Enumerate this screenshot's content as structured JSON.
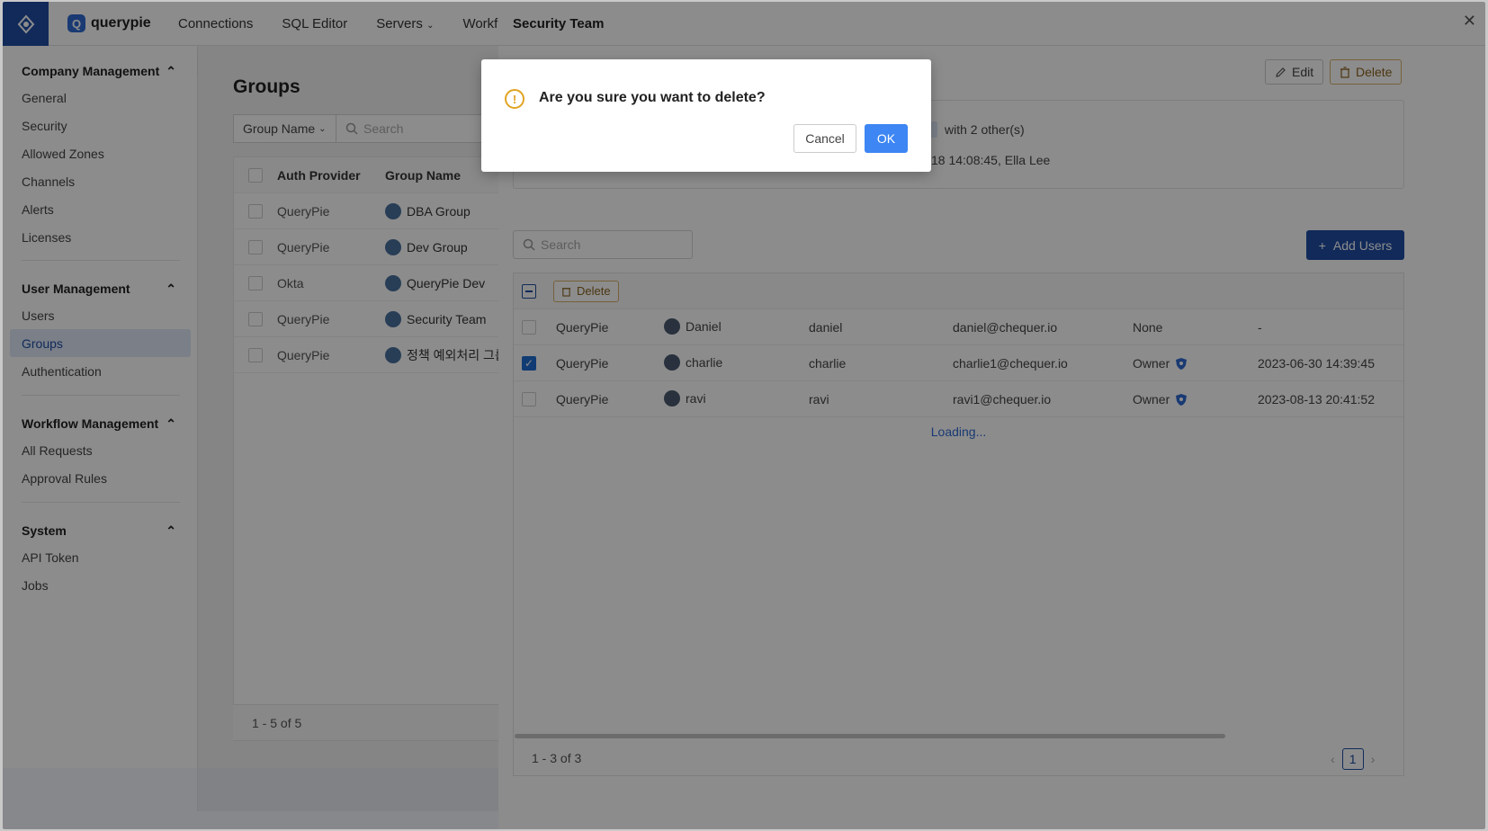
{
  "topbar": {
    "brand": "querypie",
    "nav": [
      "Connections",
      "SQL Editor",
      "Servers",
      "Workfl"
    ]
  },
  "sidebar": {
    "sections": [
      {
        "title": "Company Management",
        "items": [
          "General",
          "Security",
          "Allowed Zones",
          "Channels",
          "Alerts",
          "Licenses"
        ]
      },
      {
        "title": "User Management",
        "items": [
          "Users",
          "Groups",
          "Authentication"
        ]
      },
      {
        "title": "Workflow Management",
        "items": [
          "All Requests",
          "Approval Rules"
        ]
      },
      {
        "title": "System",
        "items": [
          "API Token",
          "Jobs"
        ]
      }
    ],
    "active": "Groups"
  },
  "groups": {
    "title": "Groups",
    "filter_select": "Group Name",
    "search_placeholder": "Search",
    "headers": [
      "Auth Provider",
      "Group Name"
    ],
    "rows": [
      {
        "provider": "QueryPie",
        "name": "DBA Group"
      },
      {
        "provider": "QueryPie",
        "name": "Dev Group"
      },
      {
        "provider": "Okta",
        "name": "QueryPie Dev"
      },
      {
        "provider": "QueryPie",
        "name": "Security Team"
      },
      {
        "provider": "QueryPie",
        "name": "정책 예외처리 그룹"
      }
    ],
    "footer": "1 - 5 of 5"
  },
  "drawer": {
    "title": "Security Team",
    "edit_label": "Edit",
    "delete_label": "Delete",
    "info_line1": "with 2 other(s)",
    "info_line2": "18 14:08:45, Ella Lee",
    "search_placeholder": "Search",
    "add_users_label": "Add Users",
    "toolbar_delete_label": "Delete",
    "users": [
      {
        "provider": "QueryPie",
        "name": "Daniel",
        "login": "daniel",
        "email": "daniel@chequer.io",
        "role": "None",
        "date": "-",
        "checked": false
      },
      {
        "provider": "QueryPie",
        "name": "charlie",
        "login": "charlie",
        "email": "charlie1@chequer.io",
        "role": "Owner",
        "date": "2023-06-30 14:39:45",
        "checked": true
      },
      {
        "provider": "QueryPie",
        "name": "ravi",
        "login": "ravi",
        "email": "ravi1@chequer.io",
        "role": "Owner",
        "date": "2023-08-13 20:41:52",
        "checked": false
      }
    ],
    "loading": "Loading...",
    "footer": "1 - 3 of 3",
    "page": "1"
  },
  "modal": {
    "message": "Are you sure you want to delete?",
    "cancel_label": "Cancel",
    "ok_label": "OK"
  },
  "colors": {
    "primary": "#1f4da5",
    "ok": "#3d86f3",
    "warning": "#e1a422"
  }
}
